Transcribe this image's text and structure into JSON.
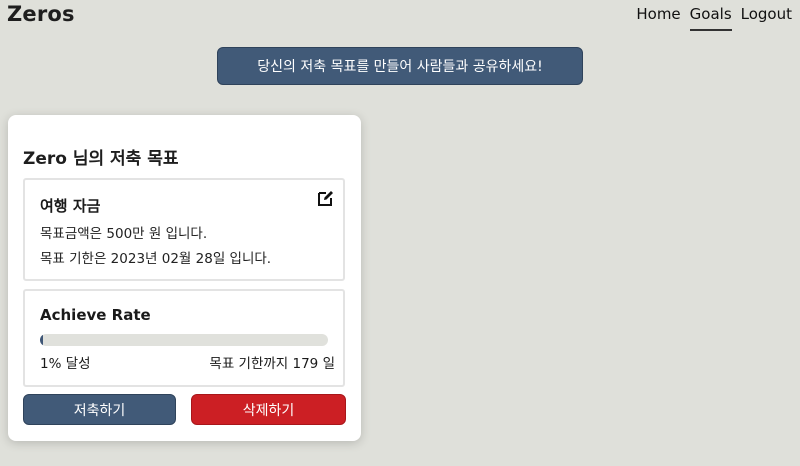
{
  "header": {
    "brand": "Zeros",
    "nav": [
      "Home",
      "Goals",
      "Logout"
    ],
    "active_nav": "Goals"
  },
  "banner": {
    "label": "당신의 저축 목표를 만들어 사람들과 공유하세요!"
  },
  "card": {
    "title": "Zero 님의 저축 목표",
    "goal": {
      "name": "여행 자금",
      "amount_text": "목표금액은 500만 원 입니다.",
      "deadline_text": "목표 기한은 2023년 02월 28일 입니다.",
      "edit_icon": "edit-icon"
    },
    "rate": {
      "title": "Achieve Rate",
      "percent": 1,
      "achieved_text": "1% 달성",
      "remaining_text": "목표 기한까지 179 일"
    },
    "buttons": {
      "save": "저축하기",
      "delete": "삭제하기"
    }
  },
  "colors": {
    "background": "#dfe0da",
    "primary": "#415a78",
    "danger": "#cc1f24",
    "progress_track": "#e0e1dc"
  }
}
